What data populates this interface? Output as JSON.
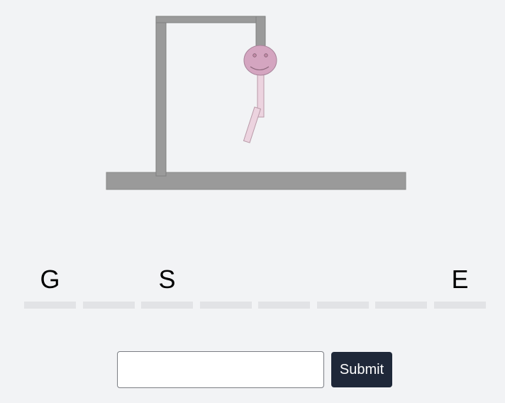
{
  "game": {
    "word_slots": [
      "G",
      "",
      "S",
      "",
      "",
      "",
      "",
      "E"
    ],
    "wrong_guess_count": 3
  },
  "guess_form": {
    "input_value": "",
    "submit_label": "Submit"
  },
  "colors": {
    "background": "#f2f3f5",
    "gallows": "#9a9a9a",
    "head": "#d4a5c0",
    "body_limbs": "#ecd3df",
    "slot_line": "#e2e3e6",
    "submit_button": "#1f2839"
  }
}
